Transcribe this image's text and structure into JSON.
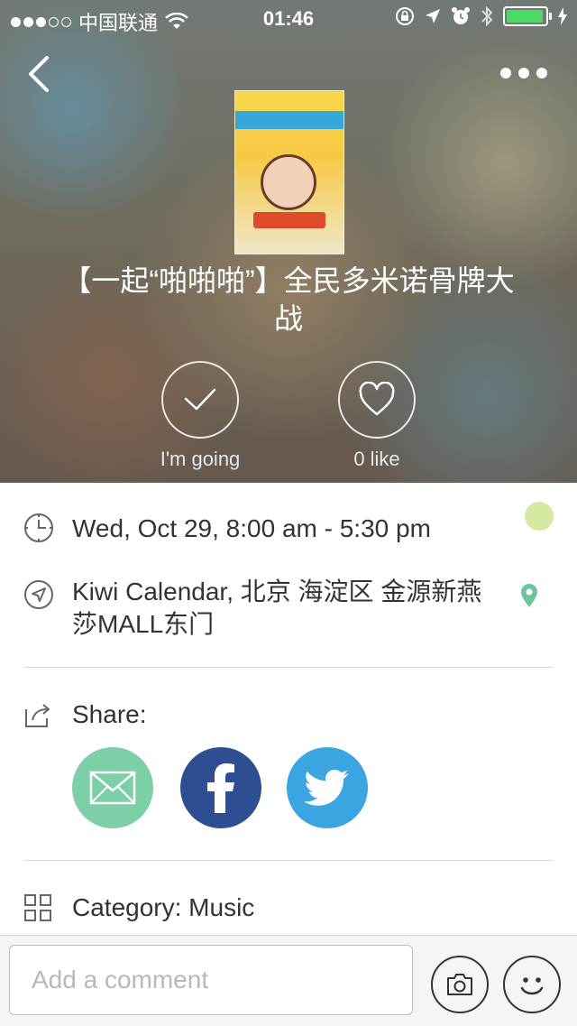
{
  "status_bar": {
    "carrier": "中国联通",
    "time": "01:46"
  },
  "event": {
    "title": "【一起“啪啪啪”】全民多米诺骨牌大战",
    "actions": {
      "going_label": "I'm going",
      "like_label": "0 like"
    },
    "datetime": "Wed, Oct 29, 8:00 am - 5:30 pm",
    "location": "Kiwi Calendar, 北京 海淀区 金源新燕莎MALL东门",
    "share_label": "Share:",
    "share_targets": [
      "email",
      "facebook",
      "twitter"
    ],
    "category": "Category: Music"
  },
  "comment_bar": {
    "placeholder": "Add a comment"
  },
  "colors": {
    "indicator": "#d6e9a0",
    "pin": "#6cc59a",
    "email": "#7dcfa7",
    "facebook": "#2f4e91",
    "twitter": "#3aa5e0",
    "battery": "#4cd964"
  }
}
